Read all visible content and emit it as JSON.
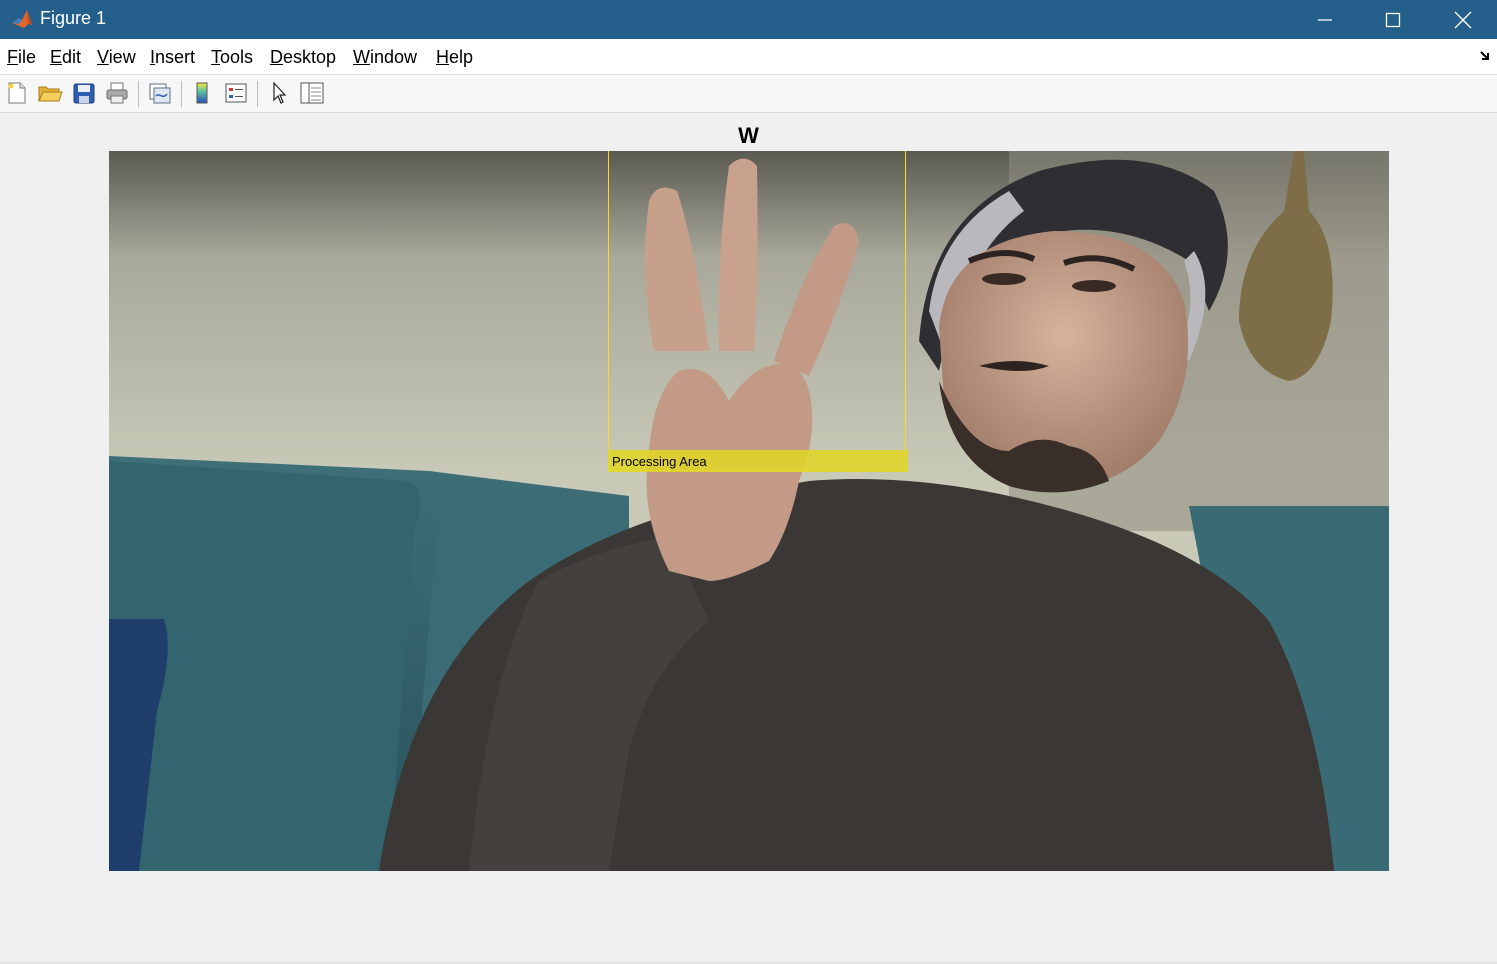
{
  "window": {
    "title": "Figure 1"
  },
  "menu": {
    "file": "File",
    "edit": "Edit",
    "view": "View",
    "insert": "Insert",
    "tools": "Tools",
    "desktop": "Desktop",
    "window": "Window",
    "help": "Help"
  },
  "toolbar": {
    "icons": [
      "new-figure-icon",
      "open-file-icon",
      "save-icon",
      "print-icon",
      "link-plot-icon",
      "insert-colorbar-icon",
      "insert-legend-icon",
      "edit-plot-pointer-icon",
      "property-inspector-icon"
    ]
  },
  "axes": {
    "title": "W"
  },
  "overlay": {
    "roi_label": "Processing Area",
    "roi_color": "#e8dc30"
  },
  "colors": {
    "titlebar": "#235f8a",
    "background": "#f0f0f0"
  }
}
